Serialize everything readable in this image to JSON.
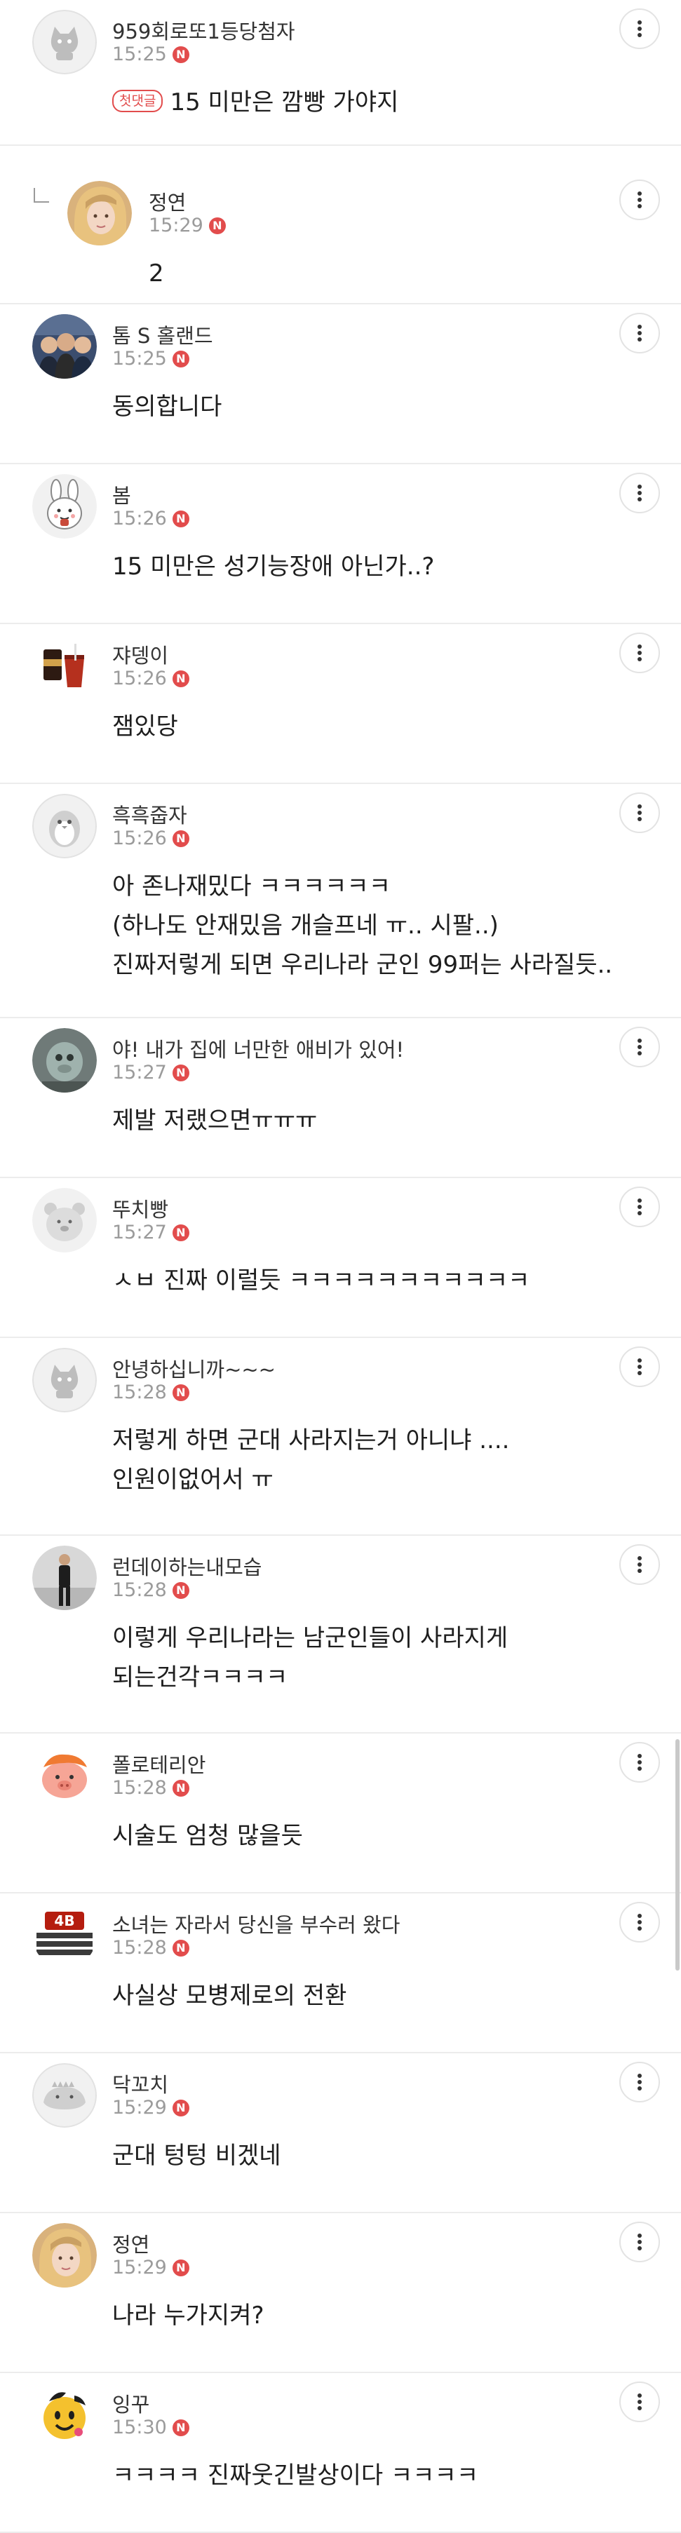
{
  "comments": [
    {
      "nickname": "959회로또1등당첨자",
      "time": "15:25",
      "new_badge": "N",
      "first_badge": "첫댓글",
      "lines": [
        "15 미만은 깜빵 가야지"
      ],
      "avatar_icon": "default-cat-avatar-icon",
      "reply": false
    },
    {
      "nickname": "정연",
      "time": "15:29",
      "new_badge": "N",
      "lines": [
        "2"
      ],
      "avatar_icon": "profile-photo-avatar-icon",
      "reply": true
    },
    {
      "nickname": "톰 S 홀랜드",
      "time": "15:25",
      "new_badge": "N",
      "lines": [
        "동의합니다"
      ],
      "avatar_icon": "group-photo-avatar-icon",
      "reply": false
    },
    {
      "nickname": "봄",
      "time": "15:26",
      "new_badge": "N",
      "lines": [
        "15 미만은 성기능장애 아닌가..?"
      ],
      "avatar_icon": "rabbit-avatar-icon",
      "reply": false
    },
    {
      "nickname": "쟈뎅이",
      "time": "15:26",
      "new_badge": "N",
      "lines": [
        "잼있당"
      ],
      "avatar_icon": "drink-avatar-icon",
      "reply": false
    },
    {
      "nickname": "흑흑줍자",
      "time": "15:26",
      "new_badge": "N",
      "lines": [
        "아 존나재밌다 ㅋㅋㅋㅋㅋㅋ",
        "(하나도 안재밌음 개슬프네 ㅠ.. 시팔..)",
        "진짜저렇게 되면 우리나라 군인 99퍼는 사라질듯.."
      ],
      "avatar_icon": "penguin-avatar-icon",
      "reply": false
    },
    {
      "nickname": "야! 내가 집에 너만한 애비가 있어!",
      "time": "15:27",
      "new_badge": "N",
      "lines": [
        "제발 저랬으면ㅠㅠㅠ"
      ],
      "avatar_icon": "figure-avatar-icon",
      "reply": false
    },
    {
      "nickname": "뚜치빵",
      "time": "15:27",
      "new_badge": "N",
      "lines": [
        "ㅅㅂ 진짜 이럴듯 ㅋㅋㅋㅋㅋㅋㅋㅋㅋㅋㅋ"
      ],
      "avatar_icon": "bear-avatar-icon",
      "reply": false
    },
    {
      "nickname": "안녕하십니까~~~",
      "time": "15:28",
      "new_badge": "N",
      "lines": [
        "저렇게 하면 군대 사라지는거 아니냐 ....",
        "인원이없어서 ㅠ"
      ],
      "avatar_icon": "default-cat-avatar-icon",
      "reply": false
    },
    {
      "nickname": "런데이하는내모습",
      "time": "15:28",
      "new_badge": "N",
      "lines": [
        "이렇게 우리나라는 남군인들이 사라지게",
        "되는건각ㅋㅋㅋㅋ"
      ],
      "avatar_icon": "runner-photo-avatar-icon",
      "reply": false
    },
    {
      "nickname": "폴로테리안",
      "time": "15:28",
      "new_badge": "N",
      "lines": [
        "시술도 엄청 많을듯"
      ],
      "avatar_icon": "pig-character-avatar-icon",
      "reply": false
    },
    {
      "nickname": "소녀는 자라서 당신을 부수러 왔다",
      "time": "15:28",
      "new_badge": "N",
      "lines": [
        "사실상 모병제로의 전환"
      ],
      "avatar_icon": "4b-logo-avatar-icon",
      "avatar_text": "4B",
      "reply": false
    },
    {
      "nickname": "닥꼬치",
      "time": "15:29",
      "new_badge": "N",
      "lines": [
        "군대 텅텅 비겠네"
      ],
      "avatar_icon": "dino-avatar-icon",
      "reply": false
    },
    {
      "nickname": "정연",
      "time": "15:29",
      "new_badge": "N",
      "lines": [
        "나라 누가지켜?"
      ],
      "avatar_icon": "profile-photo-avatar-icon",
      "reply": false
    },
    {
      "nickname": "잉꾸",
      "time": "15:30",
      "new_badge": "N",
      "lines": [
        "ㅋㅋㅋㅋ 진짜웃긴발상이다 ㅋㅋㅋㅋ"
      ],
      "avatar_icon": "smiley-avatar-icon",
      "reply": false
    }
  ]
}
